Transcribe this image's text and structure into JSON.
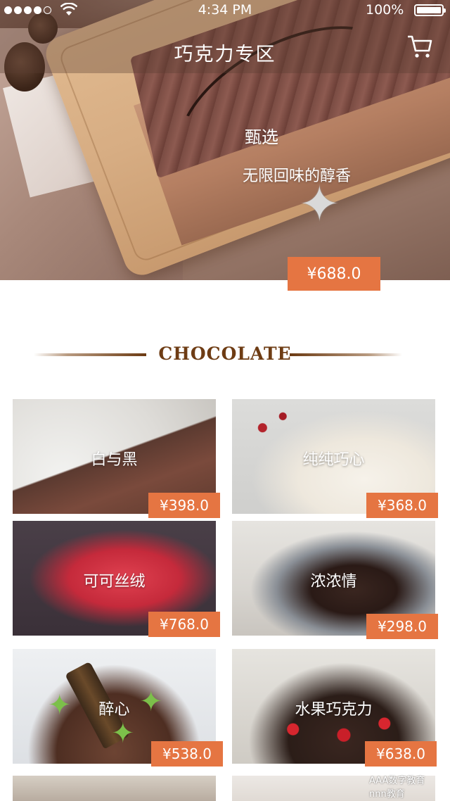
{
  "status_bar": {
    "time": "4:34 PM",
    "battery": "100%"
  },
  "nav": {
    "title": "巧克力专区",
    "cart_icon": "cart-icon"
  },
  "hero": {
    "title": "甄选",
    "subtitle": "无限回味的醇香",
    "price": "¥688.0"
  },
  "section": {
    "heading": "CHOCOLATE"
  },
  "products": [
    {
      "name": "白与黑",
      "price": "¥398.0"
    },
    {
      "name": "纯纯巧心",
      "price": "¥368.0"
    },
    {
      "name": "可可丝绒",
      "price": "¥768.0"
    },
    {
      "name": "浓浓情",
      "price": "¥298.0"
    },
    {
      "name": "醉心",
      "price": "¥538.0"
    },
    {
      "name": "水果巧克力",
      "price": "¥638.0"
    }
  ],
  "watermark": {
    "text": "AAA数字教育",
    "sub": "nnn教育"
  },
  "colors": {
    "accent": "#e57542",
    "heading": "#6e3c14"
  }
}
